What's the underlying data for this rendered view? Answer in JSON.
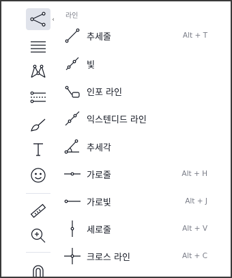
{
  "menu": {
    "header": "라인",
    "items": [
      {
        "label": "추세줄",
        "shortcut": "Alt + T",
        "icon": "trend-line-icon"
      },
      {
        "label": "빛",
        "shortcut": "",
        "icon": "ray-icon"
      },
      {
        "label": "인포 라인",
        "shortcut": "",
        "icon": "info-line-icon"
      },
      {
        "label": "익스텐디드 라인",
        "shortcut": "",
        "icon": "extended-line-icon"
      },
      {
        "label": "추세각",
        "shortcut": "",
        "icon": "trend-angle-icon"
      },
      {
        "label": "가로줄",
        "shortcut": "Alt + H",
        "icon": "horizontal-line-icon"
      },
      {
        "label": "가로빛",
        "shortcut": "Alt + J",
        "icon": "horizontal-ray-icon"
      },
      {
        "label": "세로줄",
        "shortcut": "Alt + V",
        "icon": "vertical-line-icon"
      },
      {
        "label": "크로스 라인",
        "shortcut": "Alt + C",
        "icon": "cross-line-icon"
      }
    ]
  },
  "toolbar": {
    "tools": [
      {
        "name": "line-tools-icon",
        "active": true
      },
      {
        "name": "fibonacci-icon",
        "active": false
      },
      {
        "name": "patterns-icon",
        "active": false
      },
      {
        "name": "forecasting-icon",
        "active": false
      },
      {
        "name": "brush-icon",
        "active": false
      },
      {
        "name": "text-icon",
        "active": false
      },
      {
        "name": "emoji-icon",
        "active": false
      },
      {
        "name": "ruler-icon",
        "active": false
      },
      {
        "name": "zoom-in-icon",
        "active": false
      },
      {
        "name": "magnet-icon",
        "active": false
      }
    ],
    "collapse_arrow": "‹"
  },
  "colors": {
    "active_bg": "#e0e3eb",
    "text": "#131722",
    "muted": "#787b86",
    "icon_stroke": "#131722"
  }
}
